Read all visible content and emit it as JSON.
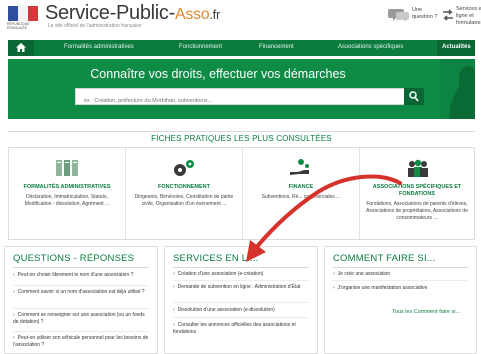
{
  "header": {
    "logo_small": "RÉPUBLIQUE FRANÇAISE",
    "brand": "Service-Public-",
    "brand_asso": "Asso",
    "brand_fr": ".fr",
    "tagline": "Le site officiel de l'administration française",
    "question_label": "Une question ?",
    "services_label": "Services en ligne et formulaires"
  },
  "nav": {
    "items": [
      "Formalités administratives",
      "Fonctionnement",
      "Financement",
      "Associations spécifiques"
    ],
    "active": "Actualités"
  },
  "hero": {
    "title": "Connaître vos droits, effectuer vos démarches",
    "search_placeholder": "ex : Création, préfecture du Morbihan, subventions..."
  },
  "fiches": {
    "title": "FICHES PRATIQUES LES PLUS CONSULTÉES",
    "cards": [
      {
        "title": "FORMALITÉS ADMINISTRATIVES",
        "desc": "Déclaration, Immatriculation, Statuts, Modification - dissolution, Agrément ..."
      },
      {
        "title": "FONCTIONNEMENT",
        "desc": "Dirigeants, Bénévoles, Constitution de partie civile, Organisation d'un événement ..."
      },
      {
        "title": "FINANCE",
        "desc": "Subventions, Ré... commerciales ..."
      },
      {
        "title": "ASSOCIATIONS SPÉCIFIQUES ET FONDATIONS",
        "desc": "Fondations, Associations de parents d'élèves, Associations de propriétaires, Associations de consommateurs ..."
      }
    ]
  },
  "qr": {
    "title": "QUESTIONS - RÉPONSES",
    "items": [
      "Peut-on choisir librement le nom d'une association ?",
      "Comment savoir si un nom d'association est déjà utilisé ?",
      "Comment se renseigner sur une association (ou un fonds de dotation) ?",
      "Peut-on utiliser son véhicule personnel pour les besoins de l'association ?"
    ]
  },
  "services": {
    "title": "SERVICES EN LI...",
    "items": [
      "Création d'une association (e-création)",
      "Demande de subvention en ligne : Administration d'État",
      "Dissolution d'une association (e-dissolution)",
      "Consulter les annonces officielles des associations et fondations"
    ]
  },
  "comment": {
    "title": "COMMENT FAIRE SI...",
    "items": [
      "Je crée une association",
      "J'organise une manifestation associative"
    ],
    "all_link": "Tous les Comment faire si..."
  },
  "colors": {
    "green": "#0b7c3e",
    "hero": "#0e8c46",
    "arrow": "#d6322c",
    "asso": "#e0892a"
  }
}
